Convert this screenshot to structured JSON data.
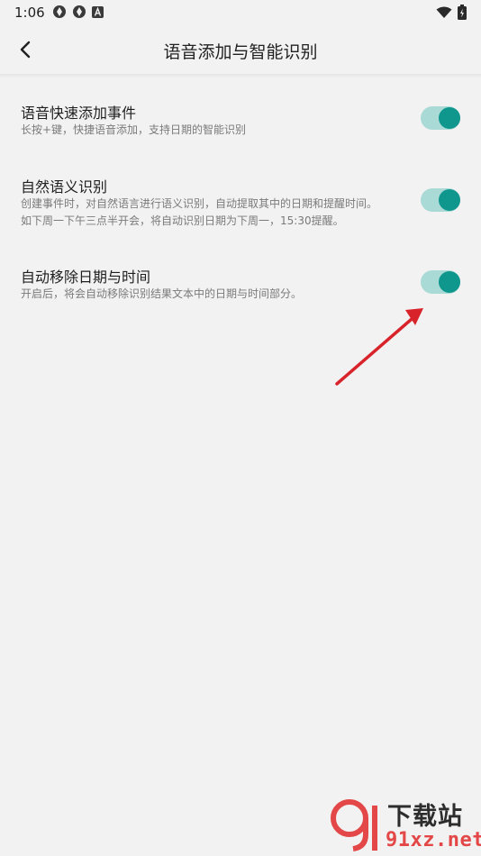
{
  "status_bar": {
    "time": "1:06"
  },
  "header": {
    "title": "语音添加与智能识别"
  },
  "settings": [
    {
      "title": "语音快速添加事件",
      "description": [
        "长按+键，快捷语音添加，支持日期的智能识别"
      ],
      "enabled": true
    },
    {
      "title": "自然语义识别",
      "description": [
        "创建事件时，对自然语言进行语义识别，自动提取其中的日期和提醒时间。",
        "如下周一下午三点半开会，将自动识别日期为下周一，15:30提醒。"
      ],
      "enabled": true
    },
    {
      "title": "自动移除日期与时间",
      "description": [
        "开启后，将会自动移除识别结果文本中的日期与时间部分。"
      ],
      "enabled": true
    }
  ],
  "watermark": {
    "title": "下载站",
    "url": "91xz.net"
  },
  "colors": {
    "accent": "#0f968d",
    "toggle_track": "#a9dad6",
    "annotation_arrow": "#d8232a"
  }
}
